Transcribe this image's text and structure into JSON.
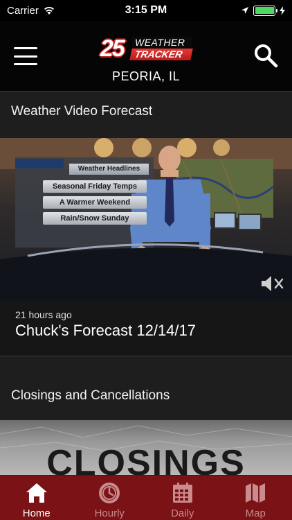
{
  "status_bar": {
    "carrier": "Carrier",
    "time": "3:15 PM"
  },
  "header": {
    "logo": {
      "number": "25",
      "line1": "WEATHER",
      "line2": "TRACKER"
    },
    "location": "PEORIA, IL"
  },
  "video_section": {
    "title": "Weather Video Forecast",
    "headlines": [
      "Weather Headlines",
      "Seasonal Friday Temps",
      "A Warmer Weekend",
      "Rain/Snow Sunday"
    ],
    "age": "21 hours ago",
    "name": "Chuck's Forecast 12/14/17"
  },
  "closings_section": {
    "title": "Closings and Cancellations",
    "banner_text": "CLOSINGS"
  },
  "tabs": [
    {
      "label": "Home",
      "icon": "home-icon",
      "active": true
    },
    {
      "label": "Hourly",
      "icon": "clock-icon",
      "active": false
    },
    {
      "label": "Daily",
      "icon": "calendar-icon",
      "active": false
    },
    {
      "label": "Map",
      "icon": "map-icon",
      "active": false
    }
  ],
  "colors": {
    "header_bg": "#050505",
    "tab_bar": "#7a1216",
    "tab_inactive": "#c98b8d",
    "logo_red": "#c62828"
  }
}
